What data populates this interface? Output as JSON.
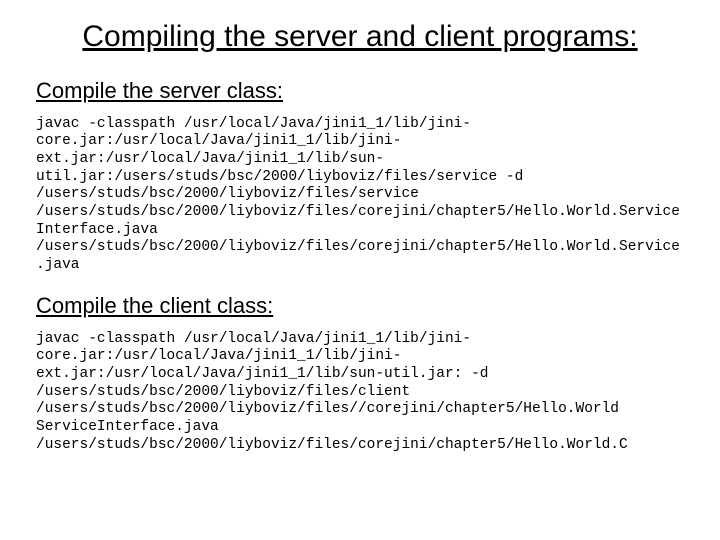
{
  "title": "Compiling the server and client programs:",
  "sections": {
    "server": {
      "heading": "Compile the server class:",
      "command": "javac -classpath /usr/local/Java/jini1_1/lib/jini-core.jar:/usr/local/Java/jini1_1/lib/jini-ext.jar:/usr/local/Java/jini1_1/lib/sun-util.jar:/users/studs/bsc/2000/liyboviz/files/service -d /users/studs/bsc/2000/liyboviz/files/service /users/studs/bsc/2000/liyboviz/files/corejini/chapter5/Hello.World.ServiceInterface.java /users/studs/bsc/2000/liyboviz/files/corejini/chapter5/Hello.World.Service.java"
    },
    "client": {
      "heading": "Compile the client class:",
      "command": "javac -classpath /usr/local/Java/jini1_1/lib/jini-core.jar:/usr/local/Java/jini1_1/lib/jini-ext.jar:/usr/local/Java/jini1_1/lib/sun-util.jar: -d /users/studs/bsc/2000/liyboviz/files/client /users/studs/bsc/2000/liyboviz/files//corejini/chapter5/Hello.World ServiceInterface.java /users/studs/bsc/2000/liyboviz/files/corejini/chapter5/Hello.World.C"
    }
  }
}
